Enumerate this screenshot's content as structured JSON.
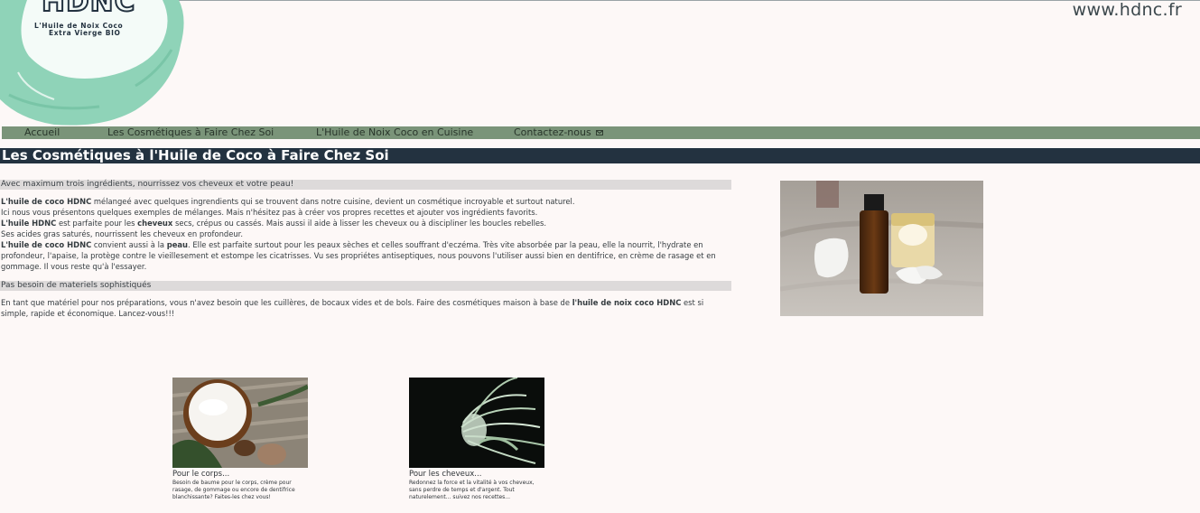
{
  "header": {
    "logo_title": "HDNC",
    "logo_line1": "L'Huile de Noix Coco",
    "logo_line2": "Extra Vierge BIO",
    "site_url": "www.hdnc.fr"
  },
  "nav": {
    "items": [
      {
        "label": "Accueil"
      },
      {
        "label": "Les Cosmétiques à Faire Chez Soi"
      },
      {
        "label": "L'Huile de Noix Coco en Cuisine"
      },
      {
        "label": "Contactez-nous"
      }
    ]
  },
  "page": {
    "title": "Les Cosmétiques à l'Huile de Coco à Faire Chez Soi",
    "section1": {
      "heading": "Avec maximum trois ingrédients, nourrissez vos cheveux et votre peau!",
      "line1_b": "L'huile de coco HDNC",
      "line1": " mélangeé avec quelques ingrendients qui se trouvent dans notre cuisine, devient un cosmétique incroyable et surtout naturel.",
      "line2": "Ici nous vous présentons quelques exemples de mélanges. Mais n'hésitez pas à créer vos propres recettes et ajouter vos ingrédients favorits.",
      "line3_b1": "L'huile HDNC",
      "line3_a": " est parfaite pour les ",
      "line3_b2": "cheveux",
      "line3_c": " secs, crépus ou cassés. Mais aussi il aide à lisser les cheveux ou à discipliner les boucles rebelles.",
      "line4": "Ses acides gras saturés, nourrissent les cheveux en profondeur.",
      "line5_b1": "L'huile de coco HDNC",
      "line5_a": " convient aussi à la ",
      "line5_b2": "peau",
      "line5_c": ". Elle est parfaite surtout pour les peaux sèches et celles souffrant d'eczéma. Très vite absorbée par la peau, elle la nourrit, l'hydrate en profondeur, l'apaise, la protège contre le vieillesement et estompe les cicatrisses. Vu ses propriétes antiseptiques, nous pouvons l'utiliser aussi bien en dentifrice, en crème de rasage et en gommage. Il vous reste qu'à l'essayer."
    },
    "section2": {
      "heading": "Pas besoin de materiels sophistiqués",
      "text_a": "En tant que matériel pour nos préparations, vous n'avez besoin que les cuillères, de bocaux vides et de bols. Faire des cosmétiques maison à base de ",
      "text_b": "l'huile de noix coco HDNC",
      "text_c": " est si simple, rapide et économique. Lancez-vous!!!"
    }
  },
  "cards": [
    {
      "title": "Pour le corps...",
      "desc": "Besoin de baume pour le corps, crème pour rasage, de gommage ou encore de dentifrice blanchissante? Faites-les chez vous!"
    },
    {
      "title": "Pour les cheveux...",
      "desc": "Redonnez la force et la vitalité à vos cheveux, sans perdre de temps et d'argent. Tout naturelement... suivez nos recettes..."
    }
  ],
  "colors": {
    "nav_bg": "#7a9479",
    "title_bg": "#233240",
    "logo_mint": "#8fd3b8",
    "page_bg": "#fdf8f7"
  }
}
